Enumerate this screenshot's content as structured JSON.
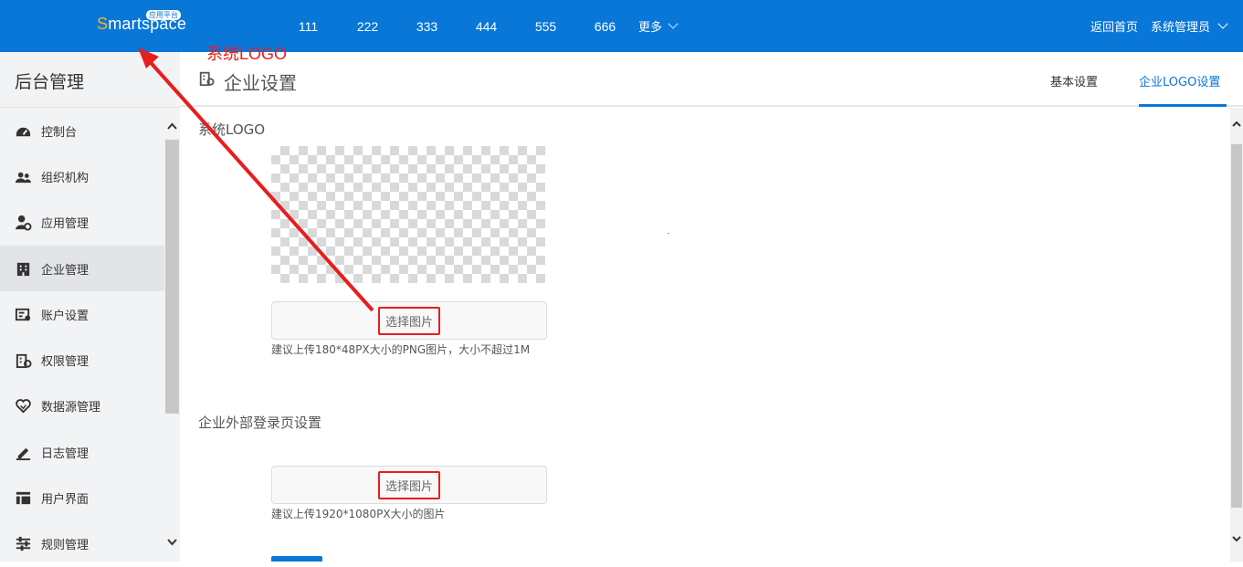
{
  "topbar": {
    "logo_text_first": "S",
    "logo_text_rest": "martspace",
    "logo_badge": "应用平台",
    "nav_items": [
      "111",
      "222",
      "333",
      "444",
      "555",
      "666"
    ],
    "more_label": "更多",
    "home_link": "返回首页",
    "user_label": "系统管理员"
  },
  "sidebar": {
    "title": "后台管理",
    "items": [
      {
        "label": "控制台",
        "icon": "dashboard-icon"
      },
      {
        "label": "组织机构",
        "icon": "users-icon"
      },
      {
        "label": "应用管理",
        "icon": "user-settings-icon"
      },
      {
        "label": "企业管理",
        "icon": "building-icon",
        "active": true
      },
      {
        "label": "账户设置",
        "icon": "account-card-icon"
      },
      {
        "label": "权限管理",
        "icon": "permission-icon"
      },
      {
        "label": "数据源管理",
        "icon": "heart-icon"
      },
      {
        "label": "日志管理",
        "icon": "pen-icon"
      },
      {
        "label": "用户界面",
        "icon": "layout-icon"
      },
      {
        "label": "规则管理",
        "icon": "sliders-icon"
      }
    ]
  },
  "main": {
    "page_title": "企业设置",
    "tabs": [
      {
        "label": "基本设置",
        "active": false
      },
      {
        "label": "企业LOGO设置",
        "active": true
      }
    ],
    "logo_section": {
      "label": "系统LOGO",
      "upload_label": "选择图片",
      "hint": "建议上传180*48PX大小的PNG图片，大小不超过1M"
    },
    "login_section": {
      "label": "企业外部登录页设置",
      "upload_label": "选择图片",
      "hint": "建议上传1920*1080PX大小的图片"
    }
  },
  "annotation": {
    "text": "系统LOGO",
    "color": "#e81d1d"
  },
  "colors": {
    "primary": "#0877d8",
    "logo_accent": "#f6b12a",
    "sidebar_bg": "#f2f3f5"
  }
}
